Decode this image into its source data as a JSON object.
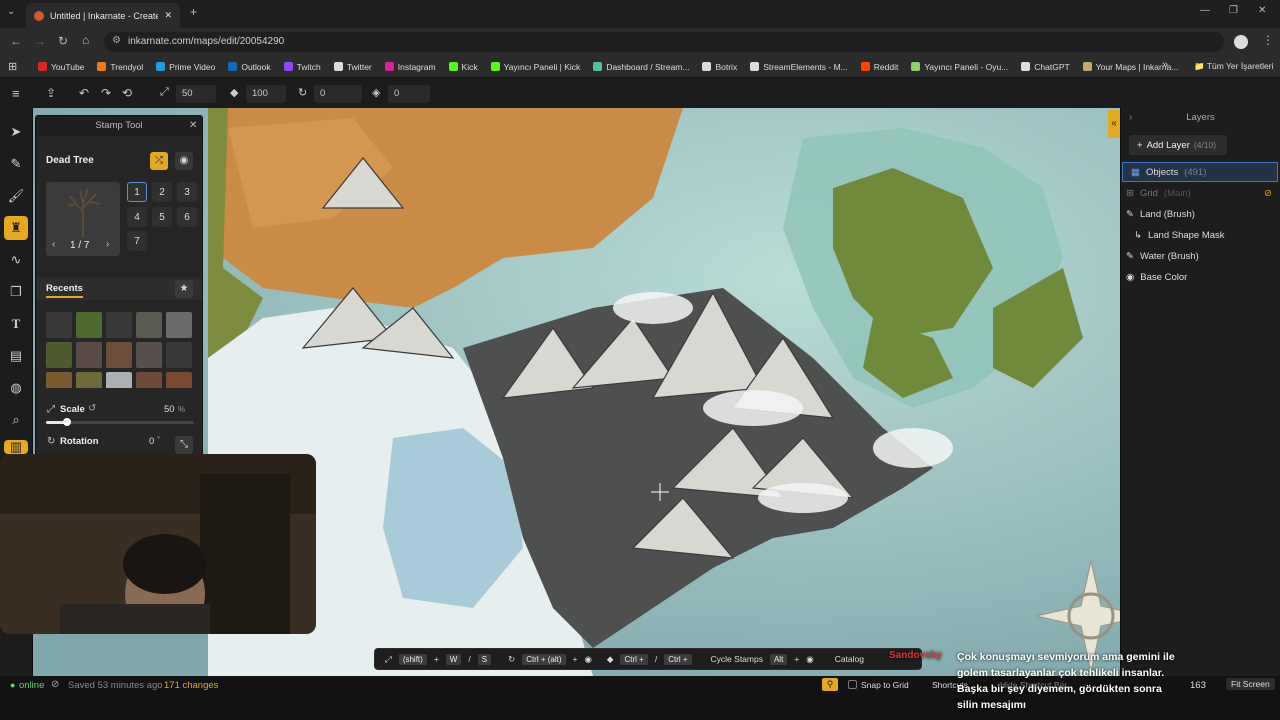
{
  "browser": {
    "tab_title": "Untitled | Inkarnate - Create Fa...",
    "url": "inkarnate.com/maps/edit/20054290",
    "bookmarks": [
      {
        "label": "YouTube",
        "color": "#e02424"
      },
      {
        "label": "Trendyol",
        "color": "#f27a1a"
      },
      {
        "label": "Prime Video",
        "color": "#1f9be0"
      },
      {
        "label": "Outlook",
        "color": "#0f6cbd"
      },
      {
        "label": "Twitch",
        "color": "#9146ff"
      },
      {
        "label": "Twitter",
        "color": "#dddddd"
      },
      {
        "label": "Instagram",
        "color": "#d6249f"
      },
      {
        "label": "Kick",
        "color": "#53fc18"
      },
      {
        "label": "Yayıncı Paneli | Kick",
        "color": "#53fc18"
      },
      {
        "label": "Dashboard / Stream...",
        "color": "#4fc3a1"
      },
      {
        "label": "Botrix",
        "color": "#dddddd"
      },
      {
        "label": "StreamElements - M...",
        "color": "#dddddd"
      },
      {
        "label": "Reddit",
        "color": "#ff4500"
      },
      {
        "label": "Yayıncı Paneli - Oyu...",
        "color": "#8fd16a"
      },
      {
        "label": "ChatGPT",
        "color": "#dddddd"
      },
      {
        "label": "Your Maps | Inkarna...",
        "color": "#c9a66b"
      }
    ],
    "all_bookmarks": "Tüm Yer İşaretleri"
  },
  "toolbar": {
    "scale": "50",
    "opacity": "100",
    "rotation": "0",
    "layer": "0"
  },
  "stamp_panel": {
    "title": "Stamp Tool",
    "stamp_name": "Dead Tree",
    "variation_counter": "1 / 7",
    "variations": [
      "1",
      "2",
      "3",
      "4",
      "5",
      "6",
      "7"
    ],
    "recents_label": "Recents",
    "scale_label": "Scale",
    "scale_value": "50",
    "scale_unit": "%",
    "scale_fraction": 0.14,
    "rotation_label": "Rotation",
    "rotation_value": "0",
    "rotation_unit": "°"
  },
  "layers_panel": {
    "title": "Layers",
    "add_layer": "Add Layer",
    "layer_count": "(4/10)",
    "layers": [
      {
        "name": "Objects",
        "extra": "(491)"
      },
      {
        "name": "Grid",
        "extra": "(Main)"
      },
      {
        "name": "Land (Brush)",
        "extra": ""
      },
      {
        "name": "Land Shape Mask",
        "extra": ""
      },
      {
        "name": "Water (Brush)",
        "extra": ""
      },
      {
        "name": "Base Color",
        "extra": ""
      }
    ]
  },
  "shortcut_bar": {
    "shift": "(shift)",
    "w": "W",
    "slash": "/",
    "s": "S",
    "ctrl_alt": "Ctrl + (alt)",
    "ctrl_plus1": "Ctrl +",
    "ctrl_plus2": "Ctrl +",
    "cycle": "Cycle Stamps",
    "alt": "Alt",
    "catalog": "Catalog"
  },
  "status": {
    "online": "online",
    "saved": "Saved 53 minutes ago",
    "changes": "171 changes",
    "snap": "Snap to Grid",
    "shortcuts": "Shortcuts",
    "hide_bar": "Hide Shortcut Bar",
    "zoom": "163",
    "fit": "Fit Screen"
  },
  "chat": {
    "user": "Sandovsky",
    "message": "Çok konuşmayı sevmiyorum ama gemini ile golem tasarlayanlar çok tehlikeli insanlar. Başka bir şey diyemem, gördükten sonra silin mesajımı"
  }
}
